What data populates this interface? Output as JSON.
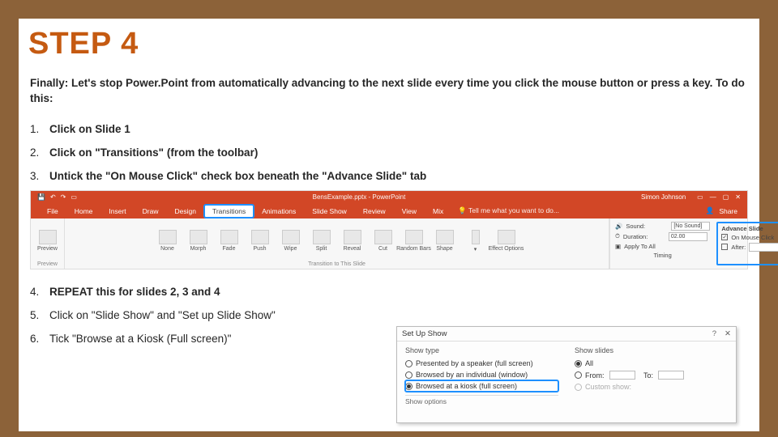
{
  "title": "STEP 4",
  "intro": "Finally: Let's stop Power.Point from automatically advancing to the next slide every time you click the mouse button or press a key. To do this:",
  "steps": [
    "Click on Slide 1",
    "Click on \"Transitions\" (from the toolbar)",
    "Untick the \"On Mouse Click\" check box beneath the \"Advance Slide\" tab",
    "REPEAT this for slides 2, 3 and 4",
    "Click on \"Slide Show\" and \"Set up Slide Show\"",
    "Tick \"Browse at a Kiosk (Full screen)\""
  ],
  "ribbon": {
    "doc_title": "BensExample.pptx - PowerPoint",
    "user": "Simon Johnson",
    "tabs": [
      "File",
      "Home",
      "Insert",
      "Draw",
      "Design",
      "Transitions",
      "Animations",
      "Slide Show",
      "Review",
      "View",
      "Mix"
    ],
    "tell_me": "Tell me what you want to do...",
    "share": "Share",
    "preview_group": "Preview",
    "preview": "Preview",
    "trans_group": "Transition to This Slide",
    "effects": [
      "None",
      "Morph",
      "Fade",
      "Push",
      "Wipe",
      "Split",
      "Reveal",
      "Cut",
      "Random Bars",
      "Shape"
    ],
    "options": "Effect Options",
    "timing_group": "Timing",
    "sound_lbl": "Sound:",
    "sound_val": "[No Sound]",
    "duration_lbl": "Duration:",
    "duration_val": "02.00",
    "apply_all": "Apply To All",
    "advance_hdr": "Advance Slide",
    "on_mouse": "On Mouse Click",
    "after_lbl": "After:"
  },
  "dialog": {
    "title": "Set Up Show",
    "q": "?",
    "x": "✕",
    "show_type": "Show type",
    "opt1": "Presented by a speaker (full screen)",
    "opt2": "Browsed by an individual (window)",
    "opt3": "Browsed at a kiosk (full screen)",
    "show_slides": "Show slides",
    "all": "All",
    "from": "From:",
    "to": "To:",
    "custom": "Custom show:",
    "show_options": "Show options"
  }
}
